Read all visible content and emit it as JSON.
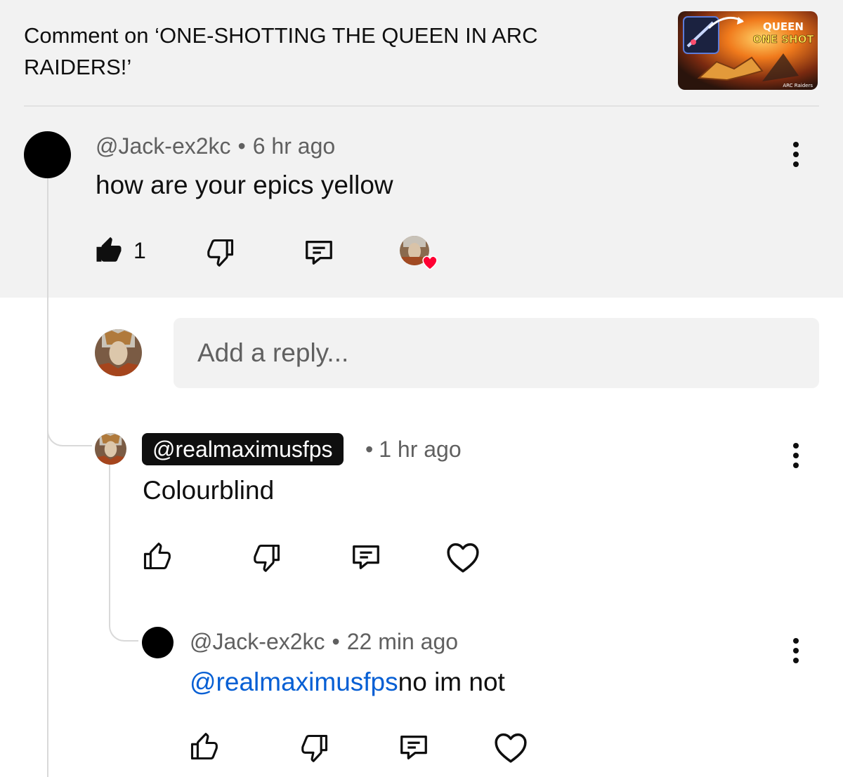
{
  "header": {
    "title": "Comment on ‘ONE-SHOTTING THE QUEEN IN ARC RAIDERS!’",
    "thumbnail": {
      "line1": "QUEEN",
      "line2": "ONE SHOT",
      "brand": "ARC Raiders"
    }
  },
  "top_comment": {
    "author": "@Jack-ex2kc",
    "separator": "•",
    "time": "6 hr ago",
    "text": "how are your epics yellow",
    "like_count": "1",
    "liked": true,
    "hearted_by_creator": true
  },
  "reply_input": {
    "placeholder": "Add a reply..."
  },
  "replies": [
    {
      "author": "@realmaximusfps",
      "is_creator": true,
      "separator": "•",
      "time": "1 hr ago",
      "text": "Colourblind"
    },
    {
      "author": "@Jack-ex2kc",
      "separator": "•",
      "time": "22 min ago",
      "mention": "@realmaximusfps",
      "text": "no im not"
    }
  ],
  "colors": {
    "page_bg": "#ffffff",
    "highlight_bg": "#f2f2f2",
    "text": "#0f0f0f",
    "secondary_text": "#606060",
    "mention": "#065fd4",
    "heart": "#ff0033",
    "thread_line": "#d9d9d9"
  },
  "icons": [
    "more-vert-icon",
    "thumb-up-icon",
    "thumb-down-icon",
    "reply-comment-icon",
    "heart-icon",
    "creator-heart-icon"
  ]
}
